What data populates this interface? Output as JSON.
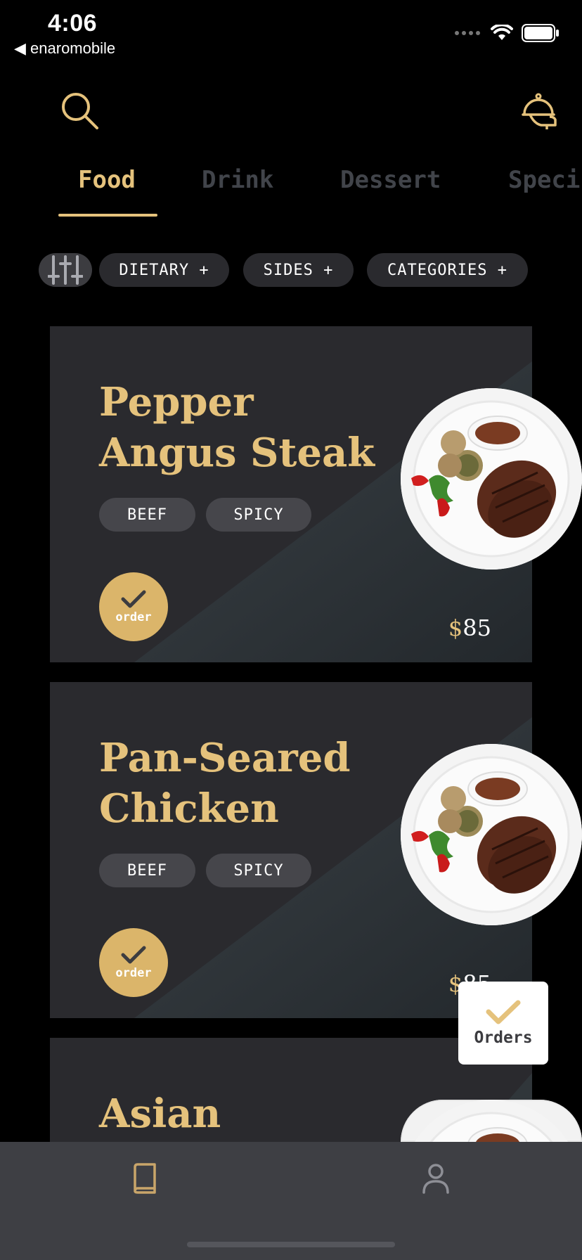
{
  "status": {
    "time": "4:06",
    "back_label": "◀ enaromobile"
  },
  "tabs": [
    {
      "label": "Food"
    },
    {
      "label": "Drink"
    },
    {
      "label": "Dessert"
    },
    {
      "label": "Speci"
    }
  ],
  "filters": {
    "chips": [
      {
        "label": "DIETARY  +"
      },
      {
        "label": "SIDES  +"
      },
      {
        "label": "CATEGORIES  +"
      }
    ]
  },
  "cards": [
    {
      "title": "Pepper Angus Steak",
      "tags": [
        "BEEF",
        "SPICY"
      ],
      "order_label": "order",
      "currency": "$",
      "price": "85"
    },
    {
      "title": "Pan-Seared Chicken",
      "tags": [
        "BEEF",
        "SPICY"
      ],
      "order_label": "order",
      "currency": "$",
      "price": "85"
    },
    {
      "title": "Asian"
    }
  ],
  "orders_fab": {
    "label": "Orders"
  },
  "colors": {
    "accent": "#e5c27c",
    "card_bg": "#2a2a2e",
    "nav_bg": "#3e3f44"
  },
  "icons": {
    "header_left": "search-icon",
    "header_right": "service-bell-icon",
    "nav_left": "book-icon",
    "nav_right": "user-icon"
  }
}
